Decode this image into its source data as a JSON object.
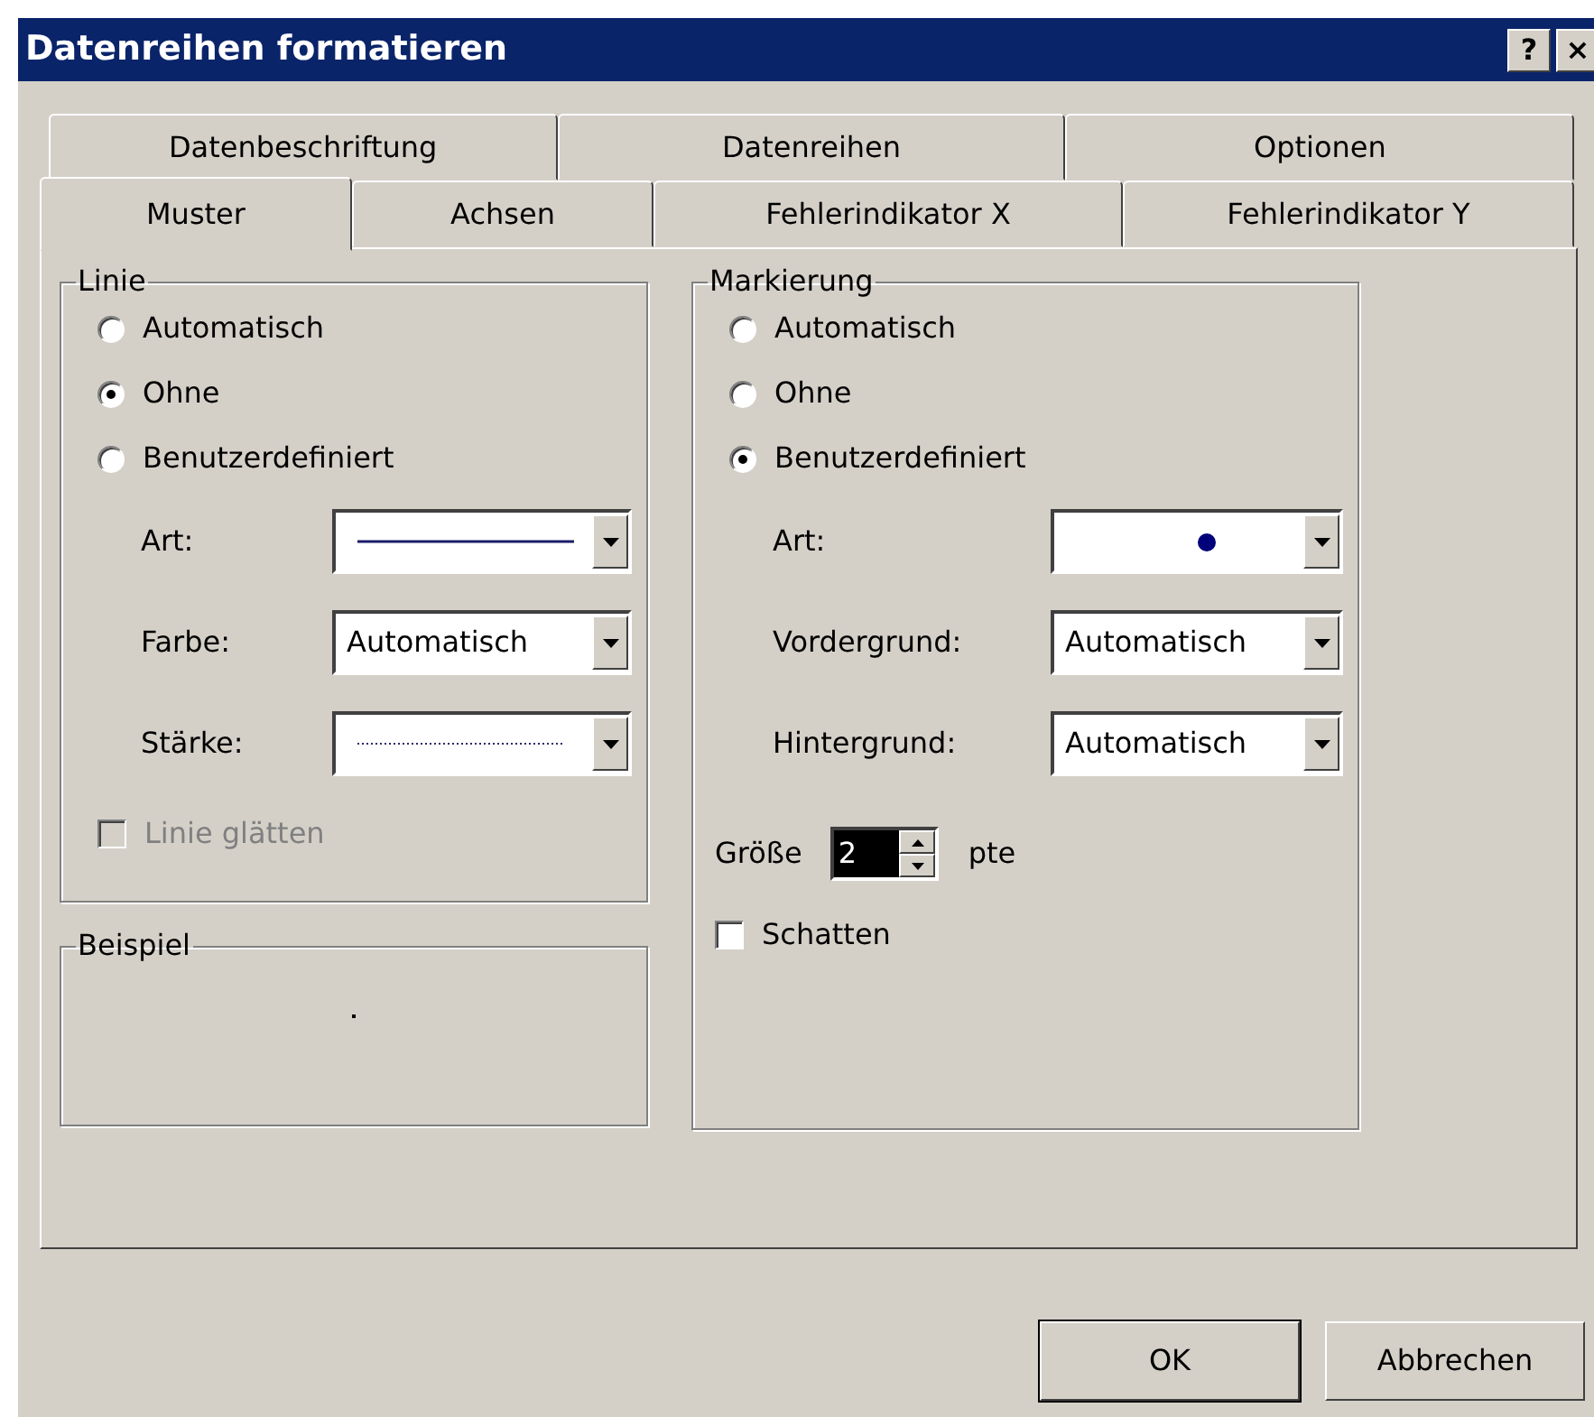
{
  "window": {
    "title": "Datenreihen formatieren",
    "title_buttons": [
      "?",
      "×"
    ]
  },
  "tabs": [
    [
      {
        "label": "Datenbeschriftung",
        "selected": false
      },
      {
        "label": "Datenreihen",
        "selected": false
      },
      {
        "label": "Optionen",
        "selected": false
      }
    ],
    [
      {
        "label": "Muster",
        "selected": true
      },
      {
        "label": "Achsen",
        "selected": false
      },
      {
        "label": "Fehlerindikator X",
        "selected": false
      },
      {
        "label": "Fehlerindikator Y",
        "selected": false
      }
    ]
  ],
  "line_group": {
    "title": "Linie",
    "options": [
      {
        "label": "Automatisch",
        "selected": false
      },
      {
        "label": "Ohne",
        "selected": true
      },
      {
        "label": "Benutzerdefiniert",
        "selected": false
      }
    ],
    "fields": [
      {
        "label": "Art:",
        "kind": "line-style"
      },
      {
        "label": "Farbe:",
        "kind": "text",
        "value": "Automatisch"
      },
      {
        "label": "Stärke:",
        "kind": "line-weight"
      }
    ],
    "smoothing": {
      "label": "Linie glätten",
      "checked": false,
      "disabled": true
    }
  },
  "sample_group": {
    "title": "Beispiel"
  },
  "marker_group": {
    "title": "Markierung",
    "options": [
      {
        "label": "Automatisch",
        "selected": false
      },
      {
        "label": "Ohne",
        "selected": false
      },
      {
        "label": "Benutzerdefiniert",
        "selected": true
      }
    ],
    "fields": [
      {
        "label": "Art:",
        "kind": "marker"
      },
      {
        "label": "Vordergrund:",
        "kind": "text",
        "value": "Automatisch"
      },
      {
        "label": "Hintergrund:",
        "kind": "text",
        "value": "Automatisch"
      }
    ],
    "size": {
      "label": "Größe",
      "value": "2",
      "unit": "pte"
    },
    "shadow": {
      "label": "Schatten",
      "checked": false,
      "disabled": false
    }
  },
  "buttons": [
    {
      "label": "OK",
      "default": true
    },
    {
      "label": "Abbrechen",
      "default": false
    }
  ]
}
